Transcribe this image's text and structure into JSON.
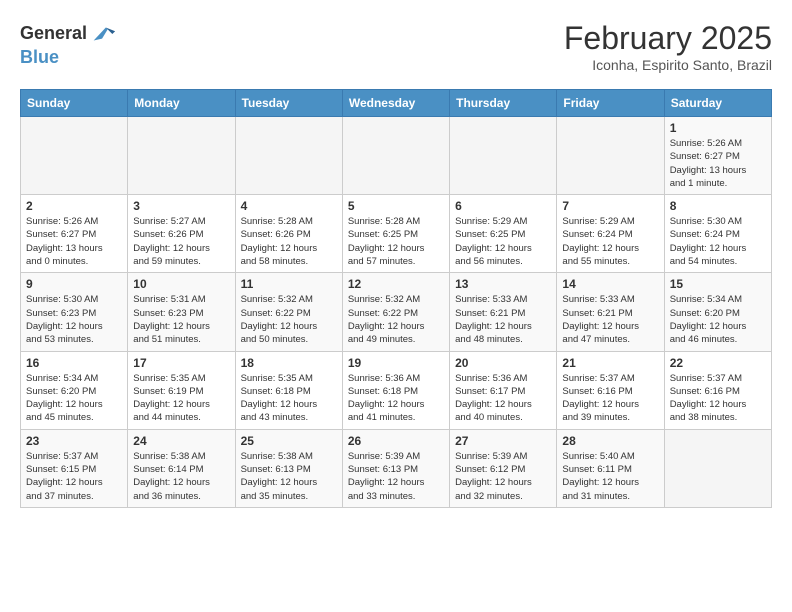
{
  "header": {
    "logo_line1": "General",
    "logo_line2": "Blue",
    "month_title": "February 2025",
    "subtitle": "Iconha, Espirito Santo, Brazil"
  },
  "days_of_week": [
    "Sunday",
    "Monday",
    "Tuesday",
    "Wednesday",
    "Thursday",
    "Friday",
    "Saturday"
  ],
  "weeks": [
    [
      {
        "day": "",
        "info": ""
      },
      {
        "day": "",
        "info": ""
      },
      {
        "day": "",
        "info": ""
      },
      {
        "day": "",
        "info": ""
      },
      {
        "day": "",
        "info": ""
      },
      {
        "day": "",
        "info": ""
      },
      {
        "day": "1",
        "info": "Sunrise: 5:26 AM\nSunset: 6:27 PM\nDaylight: 13 hours\nand 1 minute."
      }
    ],
    [
      {
        "day": "2",
        "info": "Sunrise: 5:26 AM\nSunset: 6:27 PM\nDaylight: 13 hours\nand 0 minutes."
      },
      {
        "day": "3",
        "info": "Sunrise: 5:27 AM\nSunset: 6:26 PM\nDaylight: 12 hours\nand 59 minutes."
      },
      {
        "day": "4",
        "info": "Sunrise: 5:28 AM\nSunset: 6:26 PM\nDaylight: 12 hours\nand 58 minutes."
      },
      {
        "day": "5",
        "info": "Sunrise: 5:28 AM\nSunset: 6:25 PM\nDaylight: 12 hours\nand 57 minutes."
      },
      {
        "day": "6",
        "info": "Sunrise: 5:29 AM\nSunset: 6:25 PM\nDaylight: 12 hours\nand 56 minutes."
      },
      {
        "day": "7",
        "info": "Sunrise: 5:29 AM\nSunset: 6:24 PM\nDaylight: 12 hours\nand 55 minutes."
      },
      {
        "day": "8",
        "info": "Sunrise: 5:30 AM\nSunset: 6:24 PM\nDaylight: 12 hours\nand 54 minutes."
      }
    ],
    [
      {
        "day": "9",
        "info": "Sunrise: 5:30 AM\nSunset: 6:23 PM\nDaylight: 12 hours\nand 53 minutes."
      },
      {
        "day": "10",
        "info": "Sunrise: 5:31 AM\nSunset: 6:23 PM\nDaylight: 12 hours\nand 51 minutes."
      },
      {
        "day": "11",
        "info": "Sunrise: 5:32 AM\nSunset: 6:22 PM\nDaylight: 12 hours\nand 50 minutes."
      },
      {
        "day": "12",
        "info": "Sunrise: 5:32 AM\nSunset: 6:22 PM\nDaylight: 12 hours\nand 49 minutes."
      },
      {
        "day": "13",
        "info": "Sunrise: 5:33 AM\nSunset: 6:21 PM\nDaylight: 12 hours\nand 48 minutes."
      },
      {
        "day": "14",
        "info": "Sunrise: 5:33 AM\nSunset: 6:21 PM\nDaylight: 12 hours\nand 47 minutes."
      },
      {
        "day": "15",
        "info": "Sunrise: 5:34 AM\nSunset: 6:20 PM\nDaylight: 12 hours\nand 46 minutes."
      }
    ],
    [
      {
        "day": "16",
        "info": "Sunrise: 5:34 AM\nSunset: 6:20 PM\nDaylight: 12 hours\nand 45 minutes."
      },
      {
        "day": "17",
        "info": "Sunrise: 5:35 AM\nSunset: 6:19 PM\nDaylight: 12 hours\nand 44 minutes."
      },
      {
        "day": "18",
        "info": "Sunrise: 5:35 AM\nSunset: 6:18 PM\nDaylight: 12 hours\nand 43 minutes."
      },
      {
        "day": "19",
        "info": "Sunrise: 5:36 AM\nSunset: 6:18 PM\nDaylight: 12 hours\nand 41 minutes."
      },
      {
        "day": "20",
        "info": "Sunrise: 5:36 AM\nSunset: 6:17 PM\nDaylight: 12 hours\nand 40 minutes."
      },
      {
        "day": "21",
        "info": "Sunrise: 5:37 AM\nSunset: 6:16 PM\nDaylight: 12 hours\nand 39 minutes."
      },
      {
        "day": "22",
        "info": "Sunrise: 5:37 AM\nSunset: 6:16 PM\nDaylight: 12 hours\nand 38 minutes."
      }
    ],
    [
      {
        "day": "23",
        "info": "Sunrise: 5:37 AM\nSunset: 6:15 PM\nDaylight: 12 hours\nand 37 minutes."
      },
      {
        "day": "24",
        "info": "Sunrise: 5:38 AM\nSunset: 6:14 PM\nDaylight: 12 hours\nand 36 minutes."
      },
      {
        "day": "25",
        "info": "Sunrise: 5:38 AM\nSunset: 6:13 PM\nDaylight: 12 hours\nand 35 minutes."
      },
      {
        "day": "26",
        "info": "Sunrise: 5:39 AM\nSunset: 6:13 PM\nDaylight: 12 hours\nand 33 minutes."
      },
      {
        "day": "27",
        "info": "Sunrise: 5:39 AM\nSunset: 6:12 PM\nDaylight: 12 hours\nand 32 minutes."
      },
      {
        "day": "28",
        "info": "Sunrise: 5:40 AM\nSunset: 6:11 PM\nDaylight: 12 hours\nand 31 minutes."
      },
      {
        "day": "",
        "info": ""
      }
    ]
  ]
}
